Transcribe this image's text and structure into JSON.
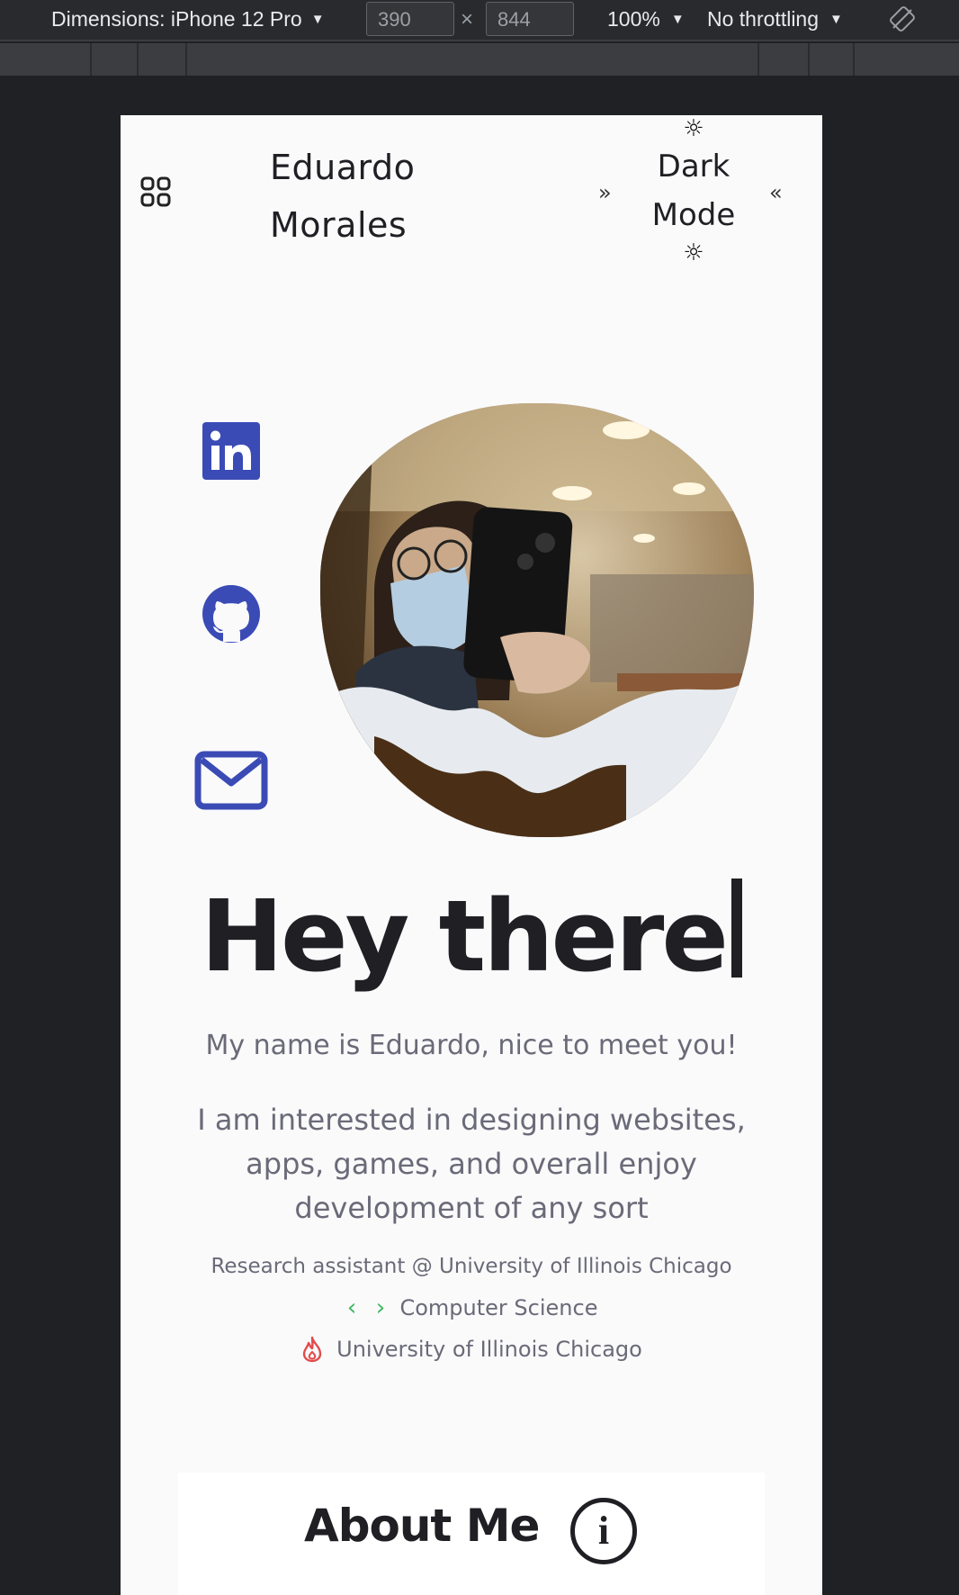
{
  "devtools": {
    "device_label": "Dimensions: iPhone 12 Pro",
    "width_value": "390",
    "height_value": "844",
    "times_symbol": "×",
    "zoom": "100%",
    "throttling": "No throttling",
    "caret": "▼"
  },
  "site": {
    "name_line1": "Eduardo",
    "name_line2": "Morales",
    "theme_toggle_line1": "Dark",
    "theme_toggle_line2": "Mode",
    "chevron_right": "»",
    "chevron_left": "«",
    "sun_glyph": "☼"
  },
  "social": [
    {
      "icon": "linkedin-icon"
    },
    {
      "icon": "github-icon"
    },
    {
      "icon": "mail-icon"
    }
  ],
  "hero": {
    "headline": "Hey there",
    "greeting": "My name is Eduardo, nice to meet you!",
    "description": "I am interested in designing websites, apps, games, and overall enjoy development of any sort",
    "role": "Research assistant @ University of Illinois Chicago",
    "major_icon": "‹ ›",
    "major": "Computer Science",
    "school": "University of Illinois Chicago"
  },
  "about": {
    "title": "About Me",
    "info_glyph": "i"
  },
  "colors": {
    "accent": "#3b4bb5",
    "code_green": "#3fb65e",
    "flame_red": "#e24c4c",
    "text_dark": "#1f1f24",
    "text_muted": "#6a6a78"
  }
}
